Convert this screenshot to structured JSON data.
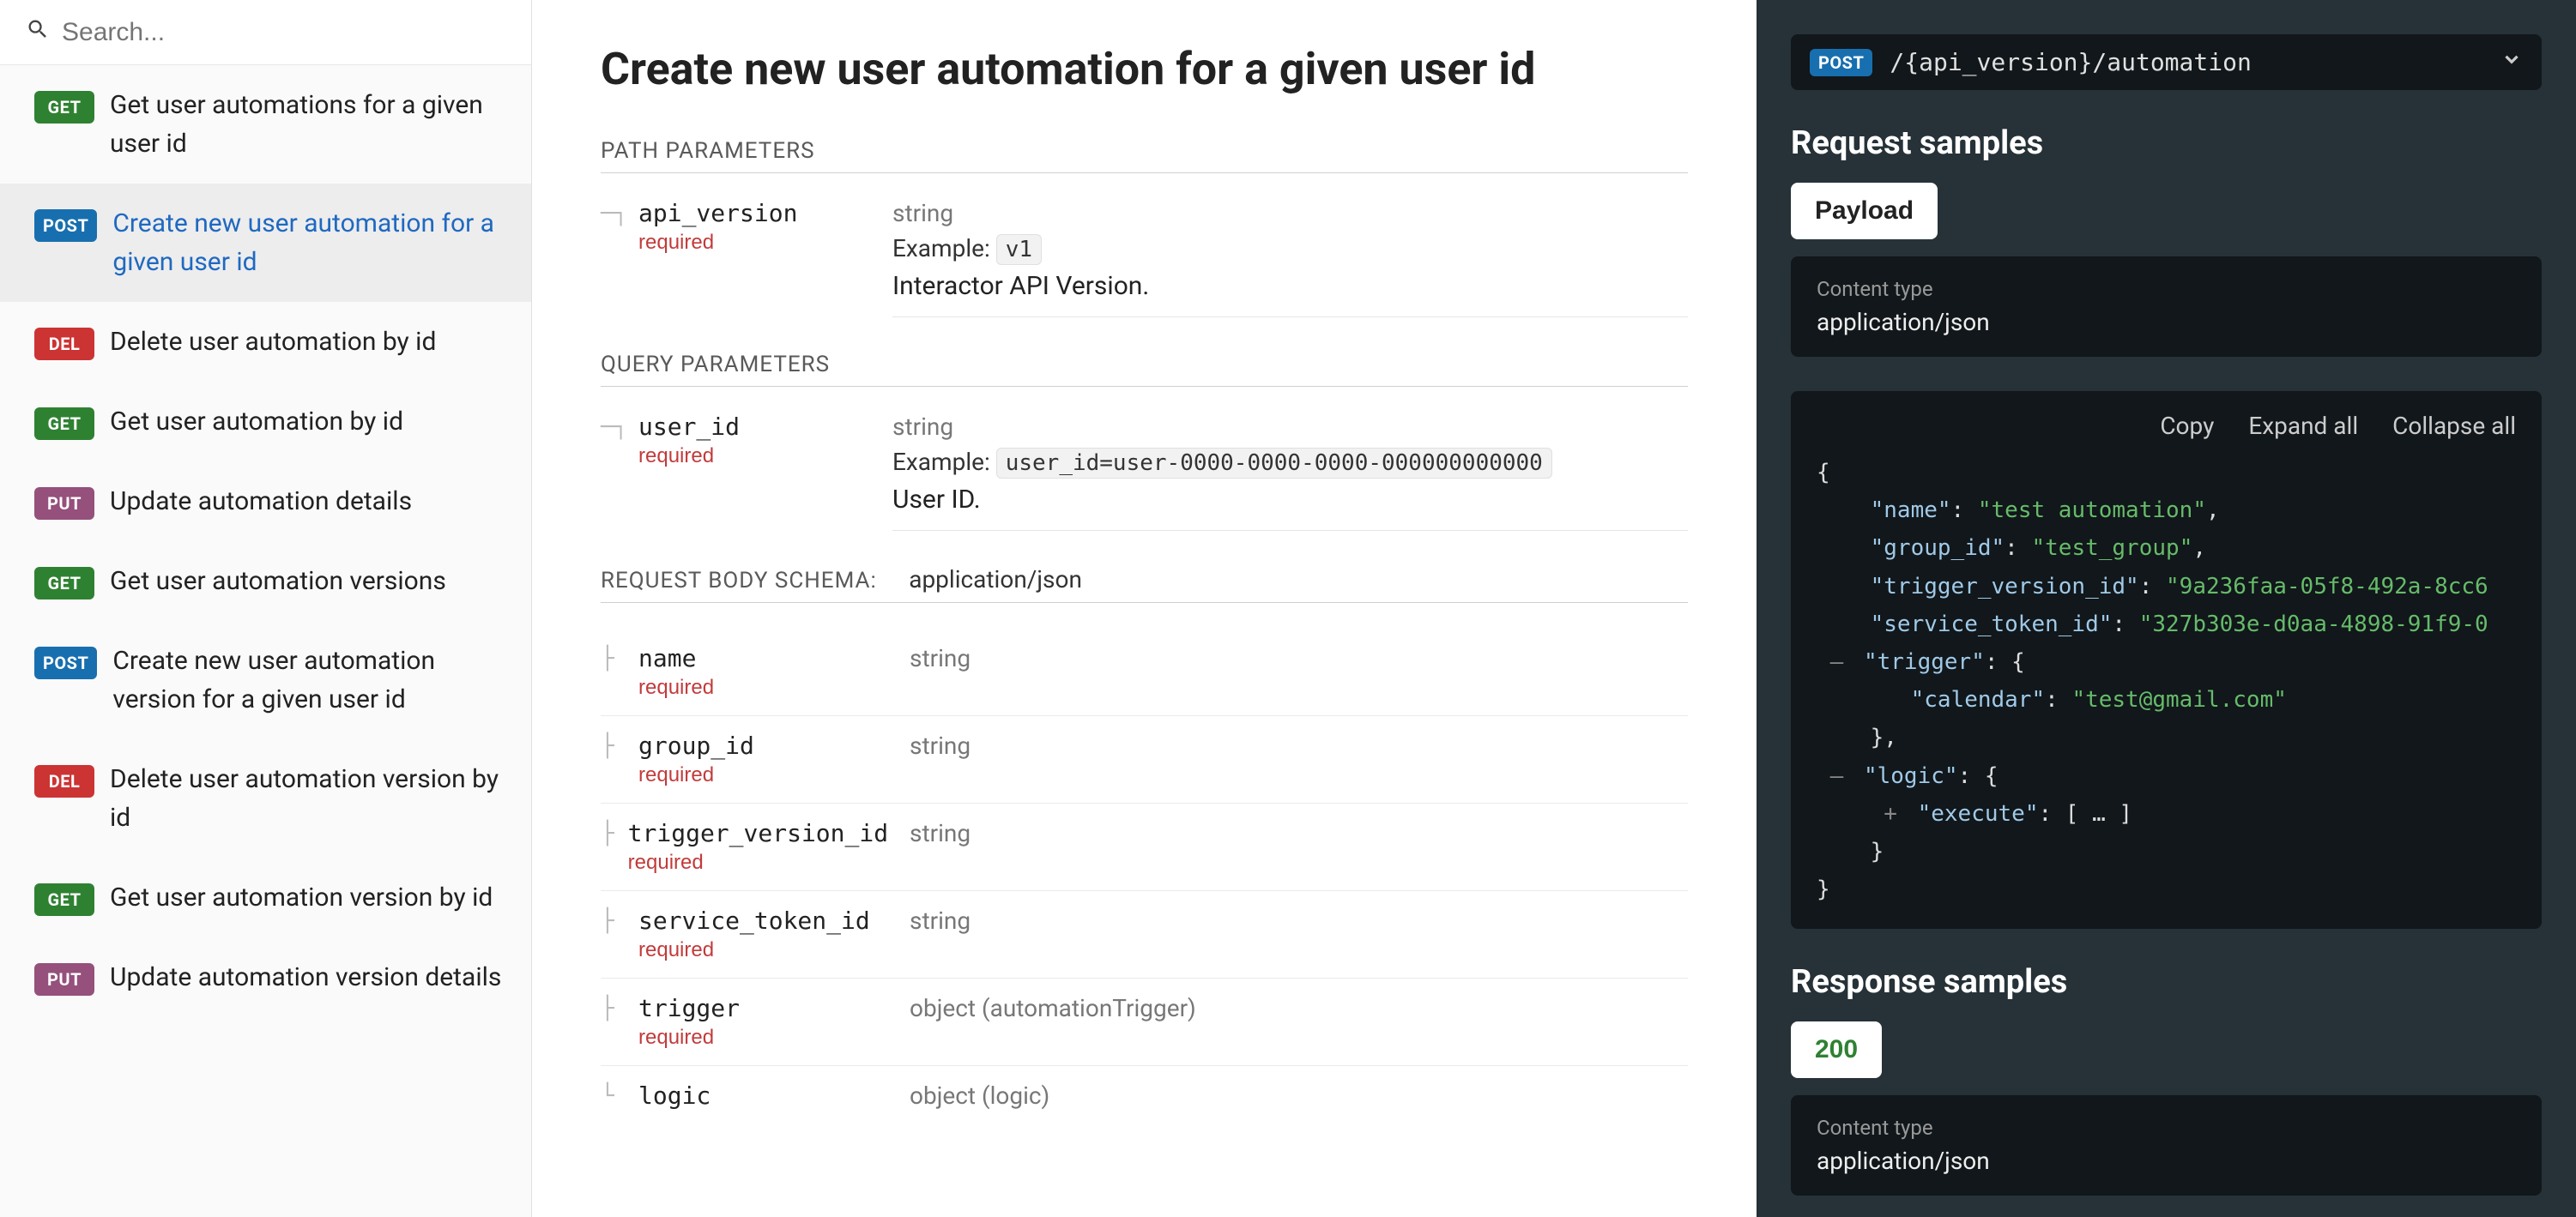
{
  "search": {
    "placeholder": "Search..."
  },
  "sidebar": {
    "items": [
      {
        "method": "GET",
        "label": "Get user automations for a given user id"
      },
      {
        "method": "POST",
        "label": "Create new user automation for a given user id",
        "active": true
      },
      {
        "method": "DEL",
        "label": "Delete user automation by id"
      },
      {
        "method": "GET",
        "label": "Get user automation by id"
      },
      {
        "method": "PUT",
        "label": "Update automation details"
      },
      {
        "method": "GET",
        "label": "Get user automation versions"
      },
      {
        "method": "POST",
        "label": "Create new user automation version for a given user id"
      },
      {
        "method": "DEL",
        "label": "Delete user automation version by id"
      },
      {
        "method": "GET",
        "label": "Get user automation version by id"
      },
      {
        "method": "PUT",
        "label": "Update automation version details"
      }
    ]
  },
  "main": {
    "title": "Create new user automation for a given user id",
    "path_params_head": "PATH PARAMETERS",
    "query_params_head": "QUERY PARAMETERS",
    "body_schema_head": "REQUEST BODY SCHEMA:",
    "body_schema_ct": "application/json",
    "required_label": "required",
    "example_label": "Example:",
    "path_params": [
      {
        "name": "api_version",
        "required": true,
        "type": "string",
        "example": "v1",
        "desc": "Interactor API Version."
      }
    ],
    "query_params": [
      {
        "name": "user_id",
        "required": true,
        "type": "string",
        "example": "user_id=user-0000-0000-0000-000000000000",
        "desc": "User ID."
      }
    ],
    "body_schema": [
      {
        "name": "name",
        "required": true,
        "type": "string"
      },
      {
        "name": "group_id",
        "required": true,
        "type": "string"
      },
      {
        "name": "trigger_version_id",
        "required": true,
        "type": "string"
      },
      {
        "name": "service_token_id",
        "required": true,
        "type": "string"
      },
      {
        "name": "trigger",
        "required": true,
        "type": "object (automationTrigger)"
      },
      {
        "name": "logic",
        "required": false,
        "type": "object (logic)"
      }
    ]
  },
  "right": {
    "endpoint_method": "POST",
    "endpoint_path": "/{api_version}/automation",
    "request_samples_head": "Request samples",
    "response_samples_head": "Response samples",
    "payload_tab": "Payload",
    "response_tab": "200",
    "content_type_label": "Content type",
    "content_type_value": "application/json",
    "actions": {
      "copy": "Copy",
      "expand": "Expand all",
      "collapse": "Collapse all"
    },
    "json_sample": {
      "name": "test automation",
      "group_id": "test_group",
      "trigger_version_id": "9a236faa-05f8-492a-8cc6",
      "service_token_id": "327b303e-d0aa-4898-91f9-0",
      "trigger": {
        "calendar": "test@gmail.com"
      },
      "logic": {
        "execute": "[ … ]"
      }
    }
  }
}
